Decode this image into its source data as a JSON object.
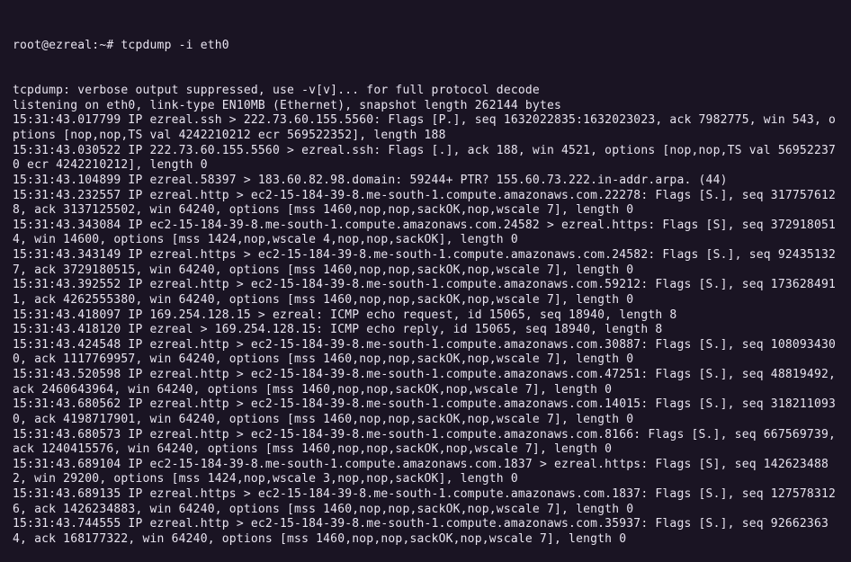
{
  "prompt": "root@ezreal:~# ",
  "command": "tcpdump -i eth0",
  "lines": [
    "tcpdump: verbose output suppressed, use -v[v]... for full protocol decode",
    "listening on eth0, link-type EN10MB (Ethernet), snapshot length 262144 bytes",
    "15:31:43.017799 IP ezreal.ssh > 222.73.60.155.5560: Flags [P.], seq 1632022835:1632023023, ack 7982775, win 543, options [nop,nop,TS val 4242210212 ecr 569522352], length 188",
    "15:31:43.030522 IP 222.73.60.155.5560 > ezreal.ssh: Flags [.], ack 188, win 4521, options [nop,nop,TS val 569522370 ecr 4242210212], length 0",
    "15:31:43.104899 IP ezreal.58397 > 183.60.82.98.domain: 59244+ PTR? 155.60.73.222.in-addr.arpa. (44)",
    "15:31:43.232557 IP ezreal.http > ec2-15-184-39-8.me-south-1.compute.amazonaws.com.22278: Flags [S.], seq 3177576128, ack 3137125502, win 64240, options [mss 1460,nop,nop,sackOK,nop,wscale 7], length 0",
    "15:31:43.343084 IP ec2-15-184-39-8.me-south-1.compute.amazonaws.com.24582 > ezreal.https: Flags [S], seq 3729180514, win 14600, options [mss 1424,nop,wscale 4,nop,nop,sackOK], length 0",
    "15:31:43.343149 IP ezreal.https > ec2-15-184-39-8.me-south-1.compute.amazonaws.com.24582: Flags [S.], seq 924351327, ack 3729180515, win 64240, options [mss 1460,nop,nop,sackOK,nop,wscale 7], length 0",
    "15:31:43.392552 IP ezreal.http > ec2-15-184-39-8.me-south-1.compute.amazonaws.com.59212: Flags [S.], seq 1736284911, ack 4262555380, win 64240, options [mss 1460,nop,nop,sackOK,nop,wscale 7], length 0",
    "15:31:43.418097 IP 169.254.128.15 > ezreal: ICMP echo request, id 15065, seq 18940, length 8",
    "15:31:43.418120 IP ezreal > 169.254.128.15: ICMP echo reply, id 15065, seq 18940, length 8",
    "15:31:43.424548 IP ezreal.http > ec2-15-184-39-8.me-south-1.compute.amazonaws.com.30887: Flags [S.], seq 1080934300, ack 1117769957, win 64240, options [mss 1460,nop,nop,sackOK,nop,wscale 7], length 0",
    "15:31:43.520598 IP ezreal.http > ec2-15-184-39-8.me-south-1.compute.amazonaws.com.47251: Flags [S.], seq 48819492, ack 2460643964, win 64240, options [mss 1460,nop,nop,sackOK,nop,wscale 7], length 0",
    "15:31:43.680562 IP ezreal.http > ec2-15-184-39-8.me-south-1.compute.amazonaws.com.14015: Flags [S.], seq 3182110930, ack 4198717901, win 64240, options [mss 1460,nop,nop,sackOK,nop,wscale 7], length 0",
    "15:31:43.680573 IP ezreal.http > ec2-15-184-39-8.me-south-1.compute.amazonaws.com.8166: Flags [S.], seq 667569739, ack 1240415576, win 64240, options [mss 1460,nop,nop,sackOK,nop,wscale 7], length 0",
    "15:31:43.689104 IP ec2-15-184-39-8.me-south-1.compute.amazonaws.com.1837 > ezreal.https: Flags [S], seq 1426234882, win 29200, options [mss 1424,nop,wscale 3,nop,nop,sackOK], length 0",
    "15:31:43.689135 IP ezreal.https > ec2-15-184-39-8.me-south-1.compute.amazonaws.com.1837: Flags [S.], seq 1275783126, ack 1426234883, win 64240, options [mss 1460,nop,nop,sackOK,nop,wscale 7], length 0",
    "15:31:43.744555 IP ezreal.http > ec2-15-184-39-8.me-south-1.compute.amazonaws.com.35937: Flags [S.], seq 926623634, ack 168177322, win 64240, options [mss 1460,nop,nop,sackOK,nop,wscale 7], length 0"
  ]
}
